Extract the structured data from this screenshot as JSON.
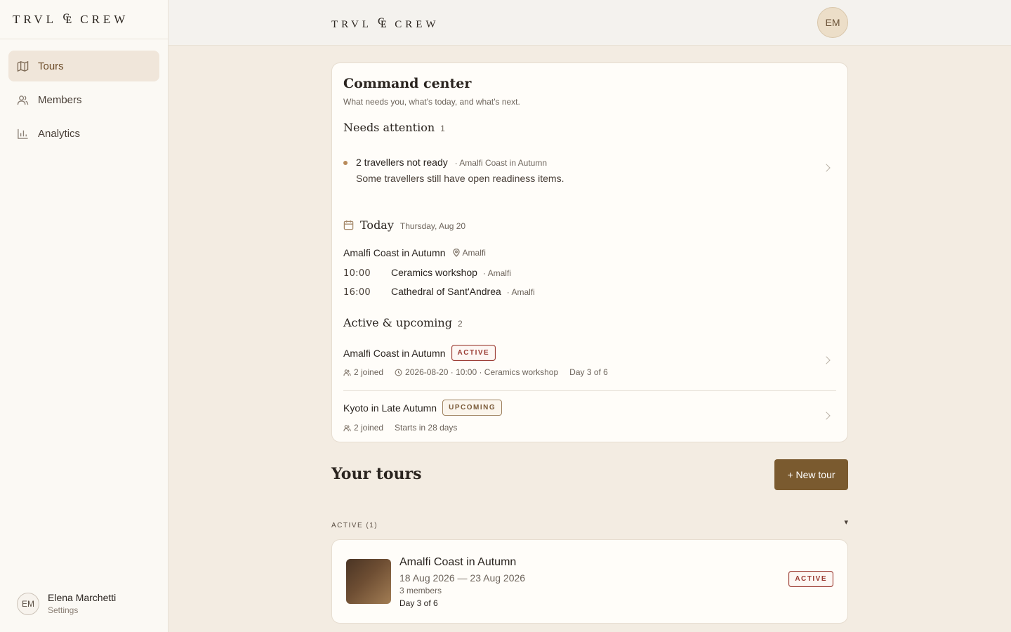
{
  "brand": {
    "logo_left": "TRVL",
    "logo_glyph": "₠",
    "logo_right": "CREW"
  },
  "sidebar": {
    "items": [
      {
        "label": "Tours",
        "icon": "map-icon",
        "active": true
      },
      {
        "label": "Members",
        "icon": "users-icon",
        "active": false
      },
      {
        "label": "Analytics",
        "icon": "bar-chart-icon",
        "active": false
      }
    ],
    "user": {
      "initials": "EM",
      "name": "Elena Marchetti",
      "settings_label": "Settings"
    }
  },
  "topbar": {
    "avatar_initials": "EM"
  },
  "command_center": {
    "title": "Command center",
    "subtitle": "What needs you, what's today, and what's next.",
    "needs_attention": {
      "title": "Needs attention",
      "count": "1",
      "items": [
        {
          "title": "2 travellers not ready",
          "tour": "· Amalfi Coast in Autumn",
          "description": "Some travellers still have open readiness items."
        }
      ]
    },
    "today": {
      "title": "Today",
      "date": "Thursday, Aug 20",
      "tour_name": "Amalfi Coast in Autumn",
      "tour_location": "Amalfi",
      "schedule": [
        {
          "time": "10:00",
          "activity": "Ceramics workshop",
          "place": "· Amalfi"
        },
        {
          "time": "16:00",
          "activity": "Cathedral of Sant'Andrea",
          "place": "· Amalfi"
        }
      ]
    },
    "active_upcoming": {
      "title": "Active & upcoming",
      "count": "2",
      "trips": [
        {
          "name": "Amalfi Coast in Autumn",
          "badge": "ACTIVE",
          "joined": "2 joined",
          "next": "2026-08-20 · 10:00 · Ceramics workshop",
          "progress": "Day 3 of 6"
        },
        {
          "name": "Kyoto in Late Autumn",
          "badge": "UPCOMING",
          "joined": "2 joined",
          "starts": "Starts in 28 days"
        }
      ]
    }
  },
  "your_tours": {
    "title": "Your tours",
    "new_tour_label": "+ New tour",
    "group_label": "ACTIVE (1)",
    "group_caret": "▾",
    "tours": [
      {
        "name": "Amalfi Coast in Autumn",
        "dates": "18 Aug 2026 — 23 Aug 2026",
        "members": "3 members",
        "progress": "Day 3 of 6",
        "badge": "ACTIVE"
      }
    ]
  },
  "colors": {
    "accent": "#7a5a2f",
    "active_badge": "#9a3a32",
    "background": "#f3ece2"
  }
}
